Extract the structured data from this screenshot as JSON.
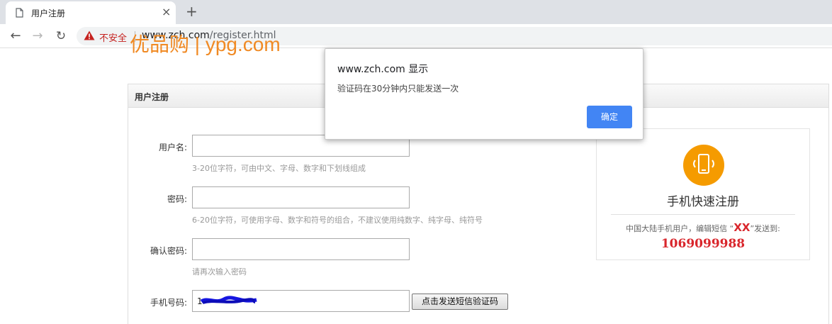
{
  "browser": {
    "tab_title": "用户注册",
    "tab_close": "×",
    "new_tab": "+",
    "security_text": "不安全",
    "url_host": "www.zch.com",
    "url_path": "/register.html"
  },
  "page": {
    "logo_text": "优品购 | ypg.com",
    "panel_title": "用户注册",
    "form": {
      "username_label": "用户名:",
      "username_value": "",
      "username_hint": "3-20位字符，可由中文、字母、数字和下划线组成",
      "password_label": "密码:",
      "password_value": "",
      "password_hint": "6-20位字符，可使用字母、数字和符号的组合，不建议使用纯数字、纯字母、纯符号",
      "confirm_label": "确认密码:",
      "confirm_value": "",
      "confirm_hint": "请再次输入密码",
      "phone_label": "手机号码:",
      "phone_value": "1",
      "sms_button": "点击发送短信验证码"
    },
    "quick_register": {
      "title": "手机快速注册",
      "desc_prefix": "中国大陆手机用户，编辑短信 “",
      "desc_code": "XX",
      "desc_suffix": "”发送到:",
      "number": "1069099988"
    }
  },
  "dialog": {
    "title": "www.zch.com 显示",
    "message": "验证码在30分钟内只能发送一次",
    "ok_label": "确定"
  },
  "colors": {
    "accent_orange": "#f08a24",
    "highlight_red": "#d9262c",
    "dialog_button": "#4285f4",
    "warning_red": "#c5221f"
  }
}
